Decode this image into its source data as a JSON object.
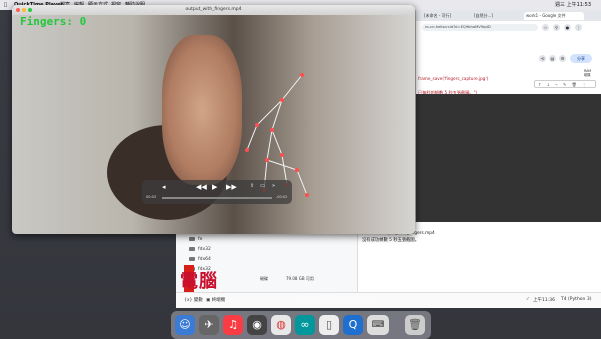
{
  "menubar": {
    "app_name": "QuickTime Player",
    "items": [
      "檔案",
      "編輯",
      "顯示方式",
      "視窗",
      "輔助說明"
    ],
    "clock": "週三 上午11:53"
  },
  "quicktime": {
    "window_title": "output_with_fingers.mp4",
    "overlay_text": "Fingers: 0",
    "time_elapsed": "00:03",
    "time_remaining": "-00:02"
  },
  "chrome": {
    "tabs": [
      "[未命名 - 可行]",
      "[自然分...]",
      "work1 - Google 文件"
    ],
    "url": "ro-cn-hellscrcid?d=EQ9bhaMV9qdD",
    "share_label": "分享",
    "ram_label": "RAM",
    "disk_label": "磁碟",
    "code_snippet_1": "frame_save('fingers_capture.jpg')",
    "code_snippet_2": "已每秒的幀數 5 秒五張截圖。\")"
  },
  "colab": {
    "output_path": "/content/output_with_fingers.mp4",
    "output_msg": "沒有成功幀數 5 秒五張截圖。",
    "folders": [
      "fe",
      "fdx32",
      "fdx64",
      "fdx32"
    ],
    "disk_label": "磁碟",
    "disk_value": "79.08 GB 可用",
    "status_left_1": "變數",
    "status_left_2": "終端機",
    "status_time": "上午11:36",
    "status_runtime": "T4 (Python 3)"
  },
  "overlay": {
    "red_text": "電腦",
    "watermark": "水平機器人2426"
  },
  "dock": {
    "apps": [
      "Finder",
      "Launchpad",
      "Music",
      "Screenshot",
      "Chrome",
      "Arduino",
      "Preview",
      "QuickTime",
      "Keyboard",
      "Trash"
    ]
  }
}
